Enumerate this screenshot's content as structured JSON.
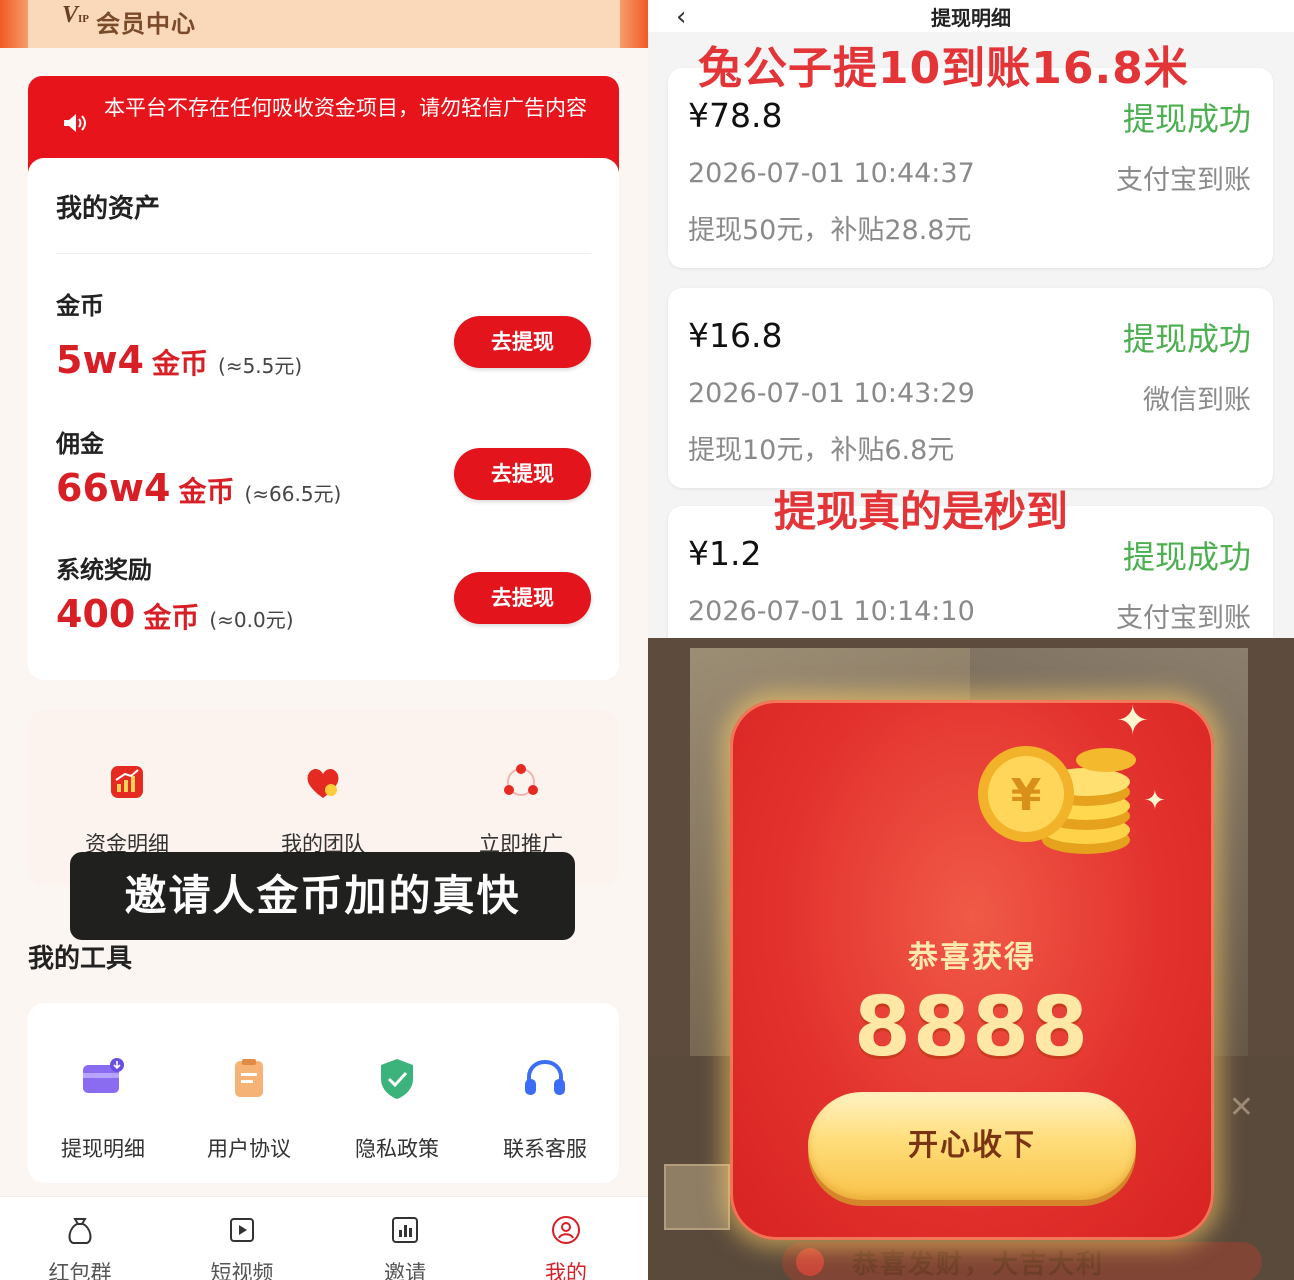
{
  "left": {
    "header": {
      "vip_logo": "V",
      "vip_logo_small": "IP",
      "title": "会员中心"
    },
    "notice": {
      "icon": "speaker-icon",
      "text": "本平台不存在任何吸收资金项目，请勿轻信广告内容"
    },
    "assets": {
      "title": "我的资产",
      "rows": [
        {
          "label": "金币",
          "amount": "5w4",
          "unit": "金币",
          "approx": "(≈5.5元)",
          "button": "去提现"
        },
        {
          "label": "佣金",
          "amount": "66w4",
          "unit": "金币",
          "approx": "(≈66.5元)",
          "button": "去提现"
        },
        {
          "label": "系统奖励",
          "amount": "400",
          "unit": "金币",
          "approx": "(≈0.0元)",
          "button": "去提现"
        }
      ]
    },
    "quick_actions": [
      {
        "label": "资金明细",
        "icon": "fund-chart-icon"
      },
      {
        "label": "我的团队",
        "icon": "team-heart-icon"
      },
      {
        "label": "立即推广",
        "icon": "share-icon"
      }
    ],
    "caption": "邀请人金币加的真快",
    "tools": {
      "title": "我的工具",
      "items": [
        {
          "label": "提现明细",
          "icon": "wallet-card-icon"
        },
        {
          "label": "用户协议",
          "icon": "document-icon"
        },
        {
          "label": "隐私政策",
          "icon": "shield-check-icon"
        },
        {
          "label": "联系客服",
          "icon": "headset-icon"
        }
      ]
    },
    "tabbar": [
      {
        "label": "红包群",
        "icon": "money-bag-icon",
        "active": false
      },
      {
        "label": "短视频",
        "icon": "video-play-icon",
        "active": false
      },
      {
        "label": "邀请",
        "icon": "chart-box-icon",
        "active": false
      },
      {
        "label": "我的",
        "icon": "user-icon",
        "active": true
      }
    ]
  },
  "right": {
    "header": {
      "back": "‹",
      "title": "提现明细"
    },
    "banner": "兔公子提10到账16.8米",
    "mid_caption": "提现真的是秒到",
    "records": [
      {
        "amount": "¥78.8",
        "status": "提现成功",
        "time": "2026-07-01 10:44:37",
        "channel": "支付宝到账",
        "note": "提现50元，补贴28.8元"
      },
      {
        "amount": "¥16.8",
        "status": "提现成功",
        "time": "2026-07-01 10:43:29",
        "channel": "微信到账",
        "note": "提现10元，补贴6.8元"
      },
      {
        "amount": "¥1.2",
        "status": "提现成功",
        "time": "2026-07-01 10:14:10",
        "channel": "支付宝到账",
        "note": ""
      }
    ]
  },
  "popup": {
    "congrats": "恭喜获得",
    "amount": "8888",
    "accept": "开心收下",
    "bless": "恭喜发财，大吉大利",
    "close": "✕"
  },
  "colors": {
    "brand_red": "#e3141c",
    "success_green": "#4caf50",
    "gold": "#ffe7a6"
  }
}
